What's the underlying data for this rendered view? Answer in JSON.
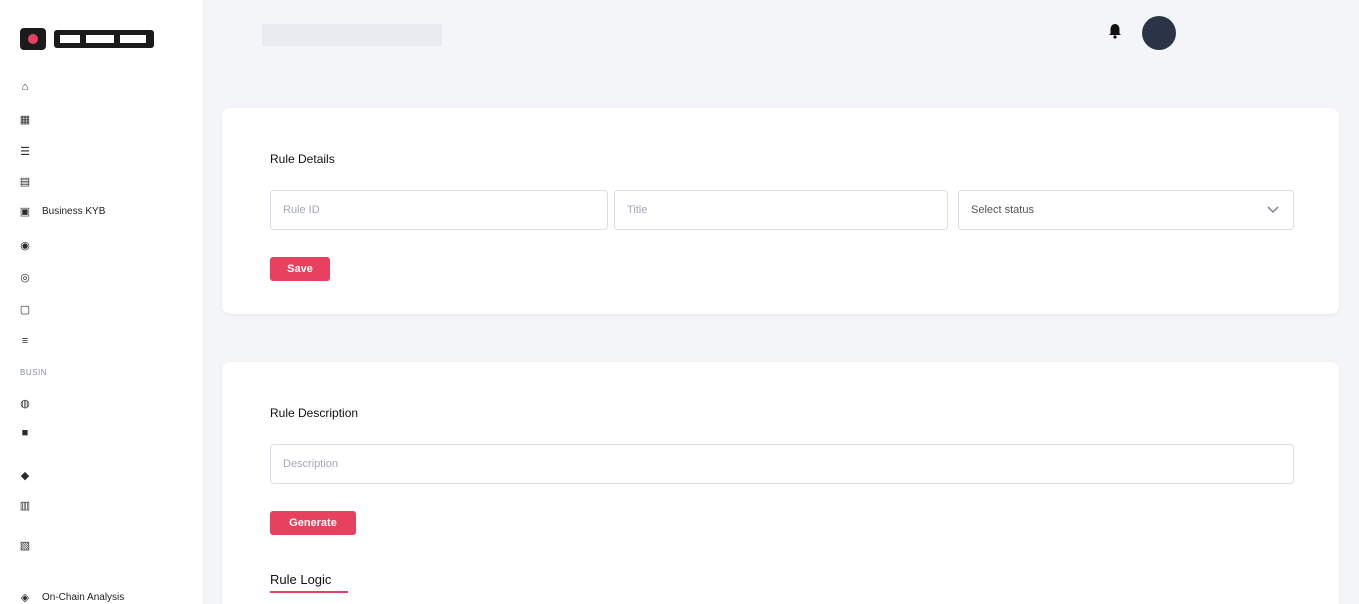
{
  "colors": {
    "accent": "#e8405f",
    "sidebar_bg": "#ffffff",
    "page_bg": "#f4f5f9"
  },
  "sidebar": {
    "items": [
      {
        "label": "",
        "icon": "home-icon"
      },
      {
        "label": "",
        "icon": "grid-icon"
      },
      {
        "label": "",
        "icon": "list-icon"
      },
      {
        "label": "",
        "icon": "chart-icon"
      },
      {
        "label": "Business KYB",
        "icon": "briefcase-icon"
      },
      {
        "label": "",
        "icon": "user-icon"
      },
      {
        "label": "",
        "icon": "users-icon"
      },
      {
        "label": "",
        "icon": "file-icon"
      },
      {
        "label": "",
        "icon": "layers-icon"
      }
    ],
    "section_business": "BUSIN",
    "bottom_items": [
      {
        "label": "",
        "icon": "globe-icon"
      },
      {
        "label": "",
        "icon": "lock-icon"
      },
      {
        "label": "",
        "icon": "shield-icon"
      },
      {
        "label": "",
        "icon": "bank-icon"
      },
      {
        "label": "",
        "icon": "doc-icon"
      },
      {
        "label": "On-Chain Analysis",
        "icon": "coins-icon"
      }
    ]
  },
  "header": {
    "user_name": ""
  },
  "rule_details": {
    "title": "Rule Details",
    "rule_id_placeholder": "Rule ID",
    "title_placeholder": "Title",
    "status_placeholder": "Select status",
    "save_label": "Save"
  },
  "rule_description": {
    "title": "Rule Description",
    "description_placeholder": "Description",
    "generate_label": "Generate"
  },
  "rule_logic": {
    "title": "Rule Logic"
  }
}
